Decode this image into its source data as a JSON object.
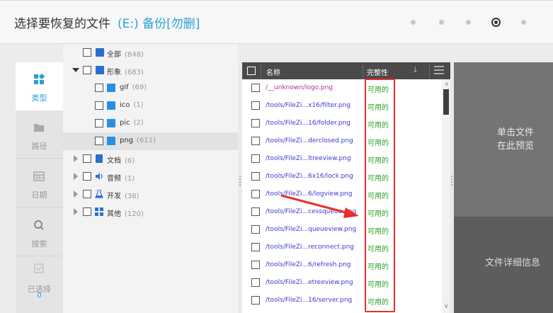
{
  "header": {
    "title": "选择要恢复的文件",
    "path": "(E:) 备份[勿删]"
  },
  "nav": {
    "items": [
      {
        "label": "类型",
        "icon": "category-icon"
      },
      {
        "label": "路径",
        "icon": "folder-icon"
      },
      {
        "label": "日期",
        "icon": "calendar-icon"
      },
      {
        "label": "搜索",
        "icon": "search-icon"
      },
      {
        "label": "已选择",
        "icon": "checkbox-icon"
      }
    ],
    "selected_count": "0"
  },
  "tree": {
    "all": {
      "label": "全部",
      "count": "(848)"
    },
    "image": {
      "label": "形象",
      "count": "(683)"
    },
    "gif": {
      "label": "gif",
      "count": "(69)"
    },
    "ico": {
      "label": "ico",
      "count": "(1)"
    },
    "pic": {
      "label": "pic",
      "count": "(2)"
    },
    "png": {
      "label": "png",
      "count": "(611)"
    },
    "docs": {
      "label": "文档",
      "count": "(6)"
    },
    "audio": {
      "label": "音频",
      "count": "(1)"
    },
    "dev": {
      "label": "开发",
      "count": "(38)"
    },
    "other": {
      "label": "其他",
      "count": "(120)"
    }
  },
  "filelist": {
    "col_name": "名称",
    "col_integrity": "完整性",
    "rows": [
      {
        "name": "/__unknown/logo.png",
        "status": "可用的"
      },
      {
        "name": "/tools/FileZi...x16/filter.png",
        "status": "可用的"
      },
      {
        "name": "/tools/FileZi...16/folder.png",
        "status": "可用的"
      },
      {
        "name": "/tools/FileZi...derclosed.png",
        "status": "可用的"
      },
      {
        "name": "/tools/FileZi...ltreeview.png",
        "status": "可用的"
      },
      {
        "name": "/tools/FileZi...6x16/lock.png",
        "status": "可用的"
      },
      {
        "name": "/tools/FileZi...6/logview.png",
        "status": "可用的"
      },
      {
        "name": "/tools/FileZi...cessqueue.png",
        "status": "可用的"
      },
      {
        "name": "/tools/FileZi...queueview.png",
        "status": "可用的"
      },
      {
        "name": "/tools/FileZi...reconnect.png",
        "status": "可用的"
      },
      {
        "name": "/tools/FileZi...6/refresh.png",
        "status": "可用的"
      },
      {
        "name": "/tools/FileZi...etreeview.png",
        "status": "可用的"
      },
      {
        "name": "/tools/FileZi...16/server.png",
        "status": "可用的"
      }
    ]
  },
  "preview": {
    "message_line1": "单击文件",
    "message_line2": "在此预览",
    "detail": "文件详细信息"
  },
  "colors": {
    "accent": "#2a9fd6",
    "status_ok": "#2aa02a",
    "highlight": "#e8302a",
    "link": "#3a3ad0"
  }
}
